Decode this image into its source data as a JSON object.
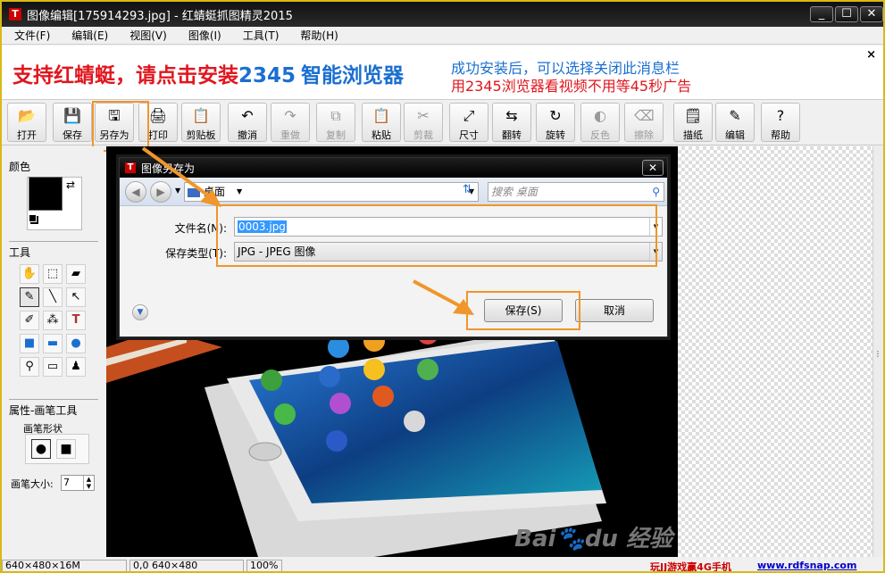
{
  "window": {
    "title": "图像编辑[175914293.jpg] - 红蜻蜓抓图精灵2015",
    "app_icon": "T",
    "minimize": "_",
    "maximize": "☐",
    "close": "✕"
  },
  "menu": [
    "文件(F)",
    "编辑(E)",
    "视图(V)",
    "图像(I)",
    "工具(T)",
    "帮助(H)"
  ],
  "ad": {
    "left_prefix": "支持红蜻蜓，请点击安装",
    "left_brand": "2345",
    "left_suffix": "智能浏览器",
    "right_line1": "成功安装后，可以选择关闭此消息栏",
    "right_line2": "用2345浏览器看视频不用等45秒广告",
    "close": "×"
  },
  "toolbar": [
    {
      "label": "打开",
      "icon": "open-folder-icon",
      "glyph": "📂",
      "disabled": false
    },
    {
      "label": "保存",
      "icon": "save-icon",
      "glyph": "💾",
      "disabled": false
    },
    {
      "label": "另存为",
      "icon": "save-as-icon",
      "glyph": "🖫",
      "disabled": false
    },
    {
      "label": "打印",
      "icon": "print-icon",
      "glyph": "🖨",
      "disabled": false
    },
    {
      "label": "剪贴板",
      "icon": "clipboard-icon",
      "glyph": "📋",
      "disabled": false
    },
    {
      "label": "撤消",
      "icon": "undo-icon",
      "glyph": "↶",
      "disabled": false
    },
    {
      "label": "重做",
      "icon": "redo-icon",
      "glyph": "↷",
      "disabled": true
    },
    {
      "label": "复制",
      "icon": "copy-icon",
      "glyph": "⧉",
      "disabled": true
    },
    {
      "label": "粘贴",
      "icon": "paste-icon",
      "glyph": "📋",
      "disabled": false
    },
    {
      "label": "剪裁",
      "icon": "crop-icon",
      "glyph": "✂",
      "disabled": true
    },
    {
      "label": "尺寸",
      "icon": "resize-icon",
      "glyph": "⤢",
      "disabled": false
    },
    {
      "label": "翻转",
      "icon": "flip-icon",
      "glyph": "⇆",
      "disabled": false
    },
    {
      "label": "旋转",
      "icon": "rotate-icon",
      "glyph": "↻",
      "disabled": false
    },
    {
      "label": "反色",
      "icon": "invert-icon",
      "glyph": "◐",
      "disabled": true
    },
    {
      "label": "擦除",
      "icon": "eraser-icon",
      "glyph": "⌫",
      "disabled": true
    },
    {
      "label": "描纸",
      "icon": "trace-icon",
      "glyph": "🗒",
      "disabled": false
    },
    {
      "label": "编辑",
      "icon": "edit-pencils-icon",
      "glyph": "✎",
      "disabled": false
    },
    {
      "label": "帮助",
      "icon": "help-icon",
      "glyph": "?",
      "disabled": false
    }
  ],
  "left_panel": {
    "color_title": "颜色",
    "tools_title": "工具",
    "props_title": "属性-画笔工具",
    "brush_shape_label": "画笔形状",
    "brush_size_label": "画笔大小:",
    "brush_size_value": "7"
  },
  "dialog": {
    "title": "图像另存为",
    "location": "桌面",
    "search_placeholder": "搜索 桌面",
    "filename_label": "文件名(N):",
    "filename_value": "0003.jpg",
    "filetype_label": "保存类型(T):",
    "filetype_value": "JPG - JPEG 图像",
    "save_button": "保存(S)",
    "cancel_button": "取消"
  },
  "status": {
    "size": "640×480×16M",
    "coords": "0,0 640×480",
    "zoom": "100%",
    "promo": "玩JJ游戏赢4G手机",
    "site": "www.rdfsnap.com"
  },
  "colors": {
    "highlight_border": "#f0962a",
    "ad_red": "#e0161e",
    "ad_blue": "#1a6fd0",
    "window_border": "#d9b915"
  }
}
